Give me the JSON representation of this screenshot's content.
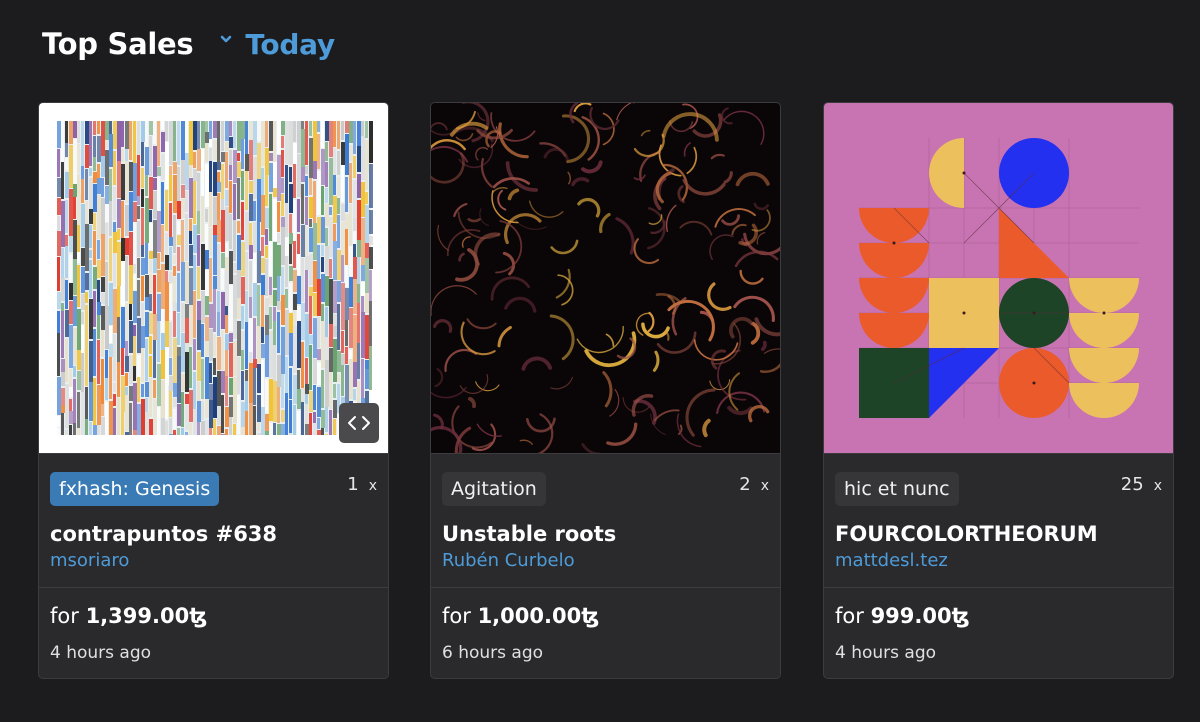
{
  "header": {
    "title": "Top Sales",
    "period": "Today"
  },
  "colors": {
    "accent": "#4e9bd9",
    "tag_highlight": "#3a7bb5",
    "background": "#1c1c1e",
    "card": "#2a2a2c"
  },
  "cards": [
    {
      "tag": "fxhash: Genesis",
      "quantity": "1",
      "quantity_suffix": "x",
      "name": "contrapuntos #638",
      "artist": "msoriaro",
      "price_prefix": "for",
      "price": "1,399.00",
      "currency": "ꜩ",
      "time": "4 hours ago",
      "icon": "code-icon"
    },
    {
      "tag": "Agitation",
      "quantity": "2",
      "quantity_suffix": "x",
      "name": "Unstable roots",
      "artist": "Rubén Curbelo",
      "price_prefix": "for",
      "price": "1,000.00",
      "currency": "ꜩ",
      "time": "6 hours ago"
    },
    {
      "tag": "hic et nunc",
      "quantity": "25",
      "quantity_suffix": "x",
      "name": "FOURCOLORTHEORUM",
      "artist": "mattdesl.tez",
      "price_prefix": "for",
      "price": "999.00",
      "currency": "ꜩ",
      "time": "4 hours ago"
    }
  ]
}
